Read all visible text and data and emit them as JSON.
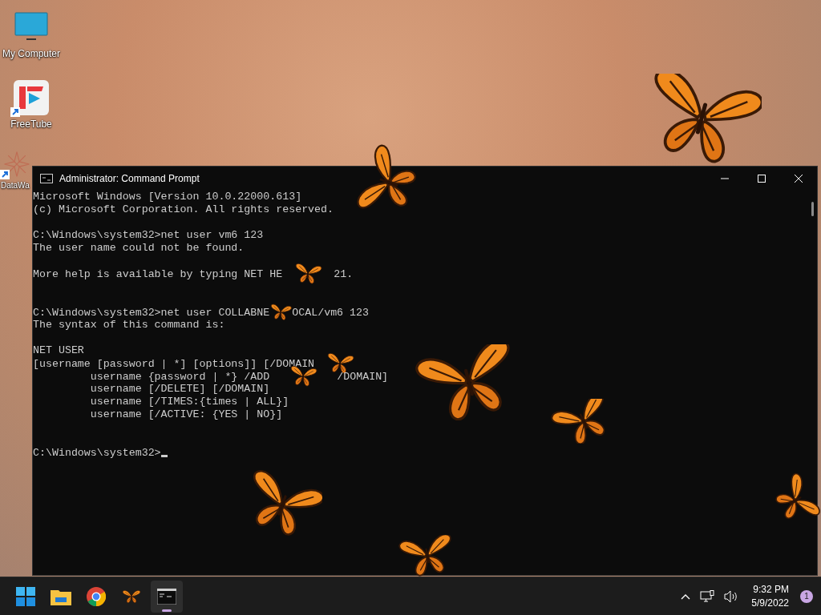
{
  "desktop": {
    "icons": [
      {
        "label": "My Computer",
        "kind": "computer",
        "shortcut": false
      },
      {
        "label": "FreeTube",
        "kind": "freetube",
        "shortcut": true
      },
      {
        "label": "DataWa",
        "kind": "datawa",
        "shortcut": true
      }
    ]
  },
  "window": {
    "title": "Administrator: Command Prompt"
  },
  "console": {
    "cursor": true,
    "lines": [
      {
        "kind": "text",
        "parts": [
          {
            "kind": "text",
            "text": "Microsoft Windows [Version 10.0.22000.613]"
          }
        ]
      },
      {
        "kind": "text",
        "parts": [
          {
            "kind": "text",
            "text": "(c) Microsoft Corporation. All rights reserved."
          }
        ]
      },
      {
        "kind": "blank"
      },
      {
        "kind": "text",
        "parts": [
          {
            "kind": "text",
            "text": "C:\\Windows\\system32>net user vm6 123"
          }
        ]
      },
      {
        "kind": "text",
        "parts": [
          {
            "kind": "text",
            "text": "The user name could not be found."
          }
        ]
      },
      {
        "kind": "blank"
      },
      {
        "kind": "text",
        "parts": [
          {
            "kind": "text",
            "text": "More help is available by typing NET HE"
          },
          {
            "kind": "butterfly"
          },
          {
            "kind": "text",
            "text": "21."
          }
        ]
      },
      {
        "kind": "blank"
      },
      {
        "kind": "blank"
      },
      {
        "kind": "text",
        "parts": [
          {
            "kind": "text",
            "text": "C:\\Windows\\system32>net user COLLABNE"
          },
          {
            "kind": "butterfly-small"
          },
          {
            "kind": "text",
            "text": "OCAL/vm6 123"
          }
        ]
      },
      {
        "kind": "text",
        "parts": [
          {
            "kind": "text",
            "text": "The syntax of this command is:"
          }
        ]
      },
      {
        "kind": "blank"
      },
      {
        "kind": "text",
        "parts": [
          {
            "kind": "text",
            "text": "NET USER"
          }
        ]
      },
      {
        "kind": "text",
        "parts": [
          {
            "kind": "text",
            "text": "[username [password | *] [options]] [/DOMAIN"
          },
          {
            "kind": "butterfly"
          }
        ]
      },
      {
        "kind": "text",
        "parts": [
          {
            "kind": "text",
            "text": "         username {password | *} /ADD"
          },
          {
            "kind": "butterfly-wide"
          },
          {
            "kind": "text",
            "text": "/DOMAIN]"
          }
        ]
      },
      {
        "kind": "text",
        "parts": [
          {
            "kind": "text",
            "text": "         username [/DELETE] [/DOMAIN]"
          }
        ]
      },
      {
        "kind": "text",
        "parts": [
          {
            "kind": "text",
            "text": "         username [/TIMES:{times | ALL}]"
          }
        ]
      },
      {
        "kind": "text",
        "parts": [
          {
            "kind": "text",
            "text": "         username [/ACTIVE: {YES | NO}]"
          }
        ]
      },
      {
        "kind": "blank"
      },
      {
        "kind": "blank"
      },
      {
        "kind": "text",
        "parts": [
          {
            "kind": "text",
            "text": "C:\\Windows\\system32>"
          }
        ]
      }
    ]
  },
  "taskbar": {
    "apps": [
      {
        "kind": "start",
        "selected": false
      },
      {
        "kind": "folder",
        "selected": false
      },
      {
        "kind": "browser",
        "selected": false
      },
      {
        "kind": "butterfly",
        "selected": false
      },
      {
        "kind": "terminal",
        "selected": true
      }
    ],
    "clock": {
      "time": "9:32 PM",
      "date": "5/9/2022"
    },
    "notifications": "1"
  }
}
